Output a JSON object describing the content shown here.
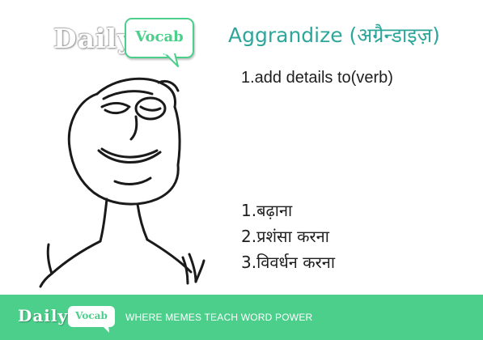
{
  "brand": {
    "daily": "Daily",
    "vocab": "Vocab",
    "tagline": "WHERE MEMES TEACH WORD POWER",
    "accent_color": "#4bcf8b",
    "word_color": "#2fa69a"
  },
  "word": {
    "title": "Aggrandize (अग्रैन्डाइज़)"
  },
  "meanings": {
    "english": [
      "1.add details to(verb)"
    ],
    "hindi": [
      "1.बढ़ाना",
      "2.प्रशंसा करना",
      "3.विवर्धन करना"
    ]
  },
  "meme": {
    "icon": "meme-face-icon"
  }
}
